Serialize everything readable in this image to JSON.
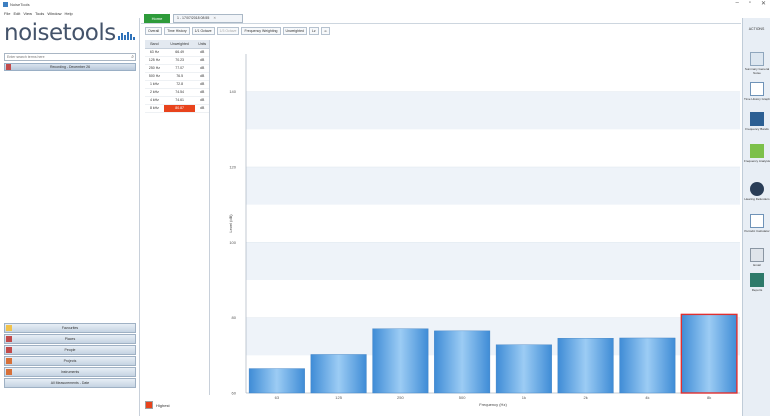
{
  "app": {
    "title": "NoiseTools",
    "logo_text": "noisetools",
    "window_controls": [
      "–",
      "▫",
      "✕"
    ]
  },
  "menu": [
    "File",
    "Edit",
    "View",
    "Tools",
    "Window",
    "Help"
  ],
  "left_panel": {
    "search_placeholder": "Enter search terms here",
    "tree_header": "Recording - December 26",
    "nav_buttons": [
      {
        "label": "Favourites",
        "color": "#f0c24b"
      },
      {
        "label": "Places",
        "color": "#c24b4b"
      },
      {
        "label": "People",
        "color": "#c24b4b"
      },
      {
        "label": "Projects",
        "color": "#d7713a"
      },
      {
        "label": "Instruments",
        "color": "#d7713a"
      },
      {
        "label": "All Measurements - Date"
      }
    ]
  },
  "tabs": {
    "home": "Home",
    "measurement": "1 - 17/07/2018 08:55"
  },
  "toolbar": {
    "items": [
      {
        "label": "Overall",
        "dim": false
      },
      {
        "label": "Time History",
        "dim": false
      },
      {
        "label": "1/1 Octave",
        "dim": false
      },
      {
        "label": "1/3 Octave",
        "dim": true
      },
      {
        "label": "Frequency Weighting",
        "dim": false
      },
      {
        "label": "Unweighted",
        "dim": false
      },
      {
        "label": "Lz",
        "dim": false
      },
      {
        "label": "◂▸",
        "dim": true
      }
    ]
  },
  "table": {
    "headers": [
      "Band",
      "Unweighted",
      "Units"
    ],
    "rows": [
      [
        "63 Hz",
        "66.49",
        "dB"
      ],
      [
        "125 Hz",
        "70.23",
        "dB"
      ],
      [
        "250 Hz",
        "77.07",
        "dB"
      ],
      [
        "500 Hz",
        "76.5",
        "dB"
      ],
      [
        "1 kHz",
        "72.8",
        "dB"
      ],
      [
        "2 kHz",
        "74.54",
        "dB"
      ],
      [
        "4 kHz",
        "74.61",
        "dB"
      ],
      [
        "8 kHz",
        "80.87",
        "dB"
      ]
    ],
    "highlight_row": 7
  },
  "chart_data": {
    "type": "bar",
    "categories": [
      "63",
      "125",
      "250",
      "500",
      "1k",
      "2k",
      "4k",
      "8k"
    ],
    "values": [
      66.49,
      70.23,
      77.07,
      76.5,
      72.8,
      74.54,
      74.61,
      80.87
    ],
    "highlight_index": 7,
    "ylabel": "Level (dB)",
    "xlabel": "Frequency (Hz)",
    "yticks": [
      60,
      80,
      100,
      120,
      140
    ],
    "ylim": [
      60,
      150
    ],
    "bar_color": "#5fa6e6",
    "highlight_border": "#e03030"
  },
  "footer": {
    "legend_label": "Highest",
    "legend_color": "#e8431c"
  },
  "right_panel": {
    "header": "ACTIONS",
    "items": [
      "Summary General Noise",
      "Time History Graph",
      "Frequency Bands",
      "Frequency Analysis",
      "Hearing Defenders",
      "Periodic Calculator",
      "Email",
      "Reports"
    ]
  }
}
